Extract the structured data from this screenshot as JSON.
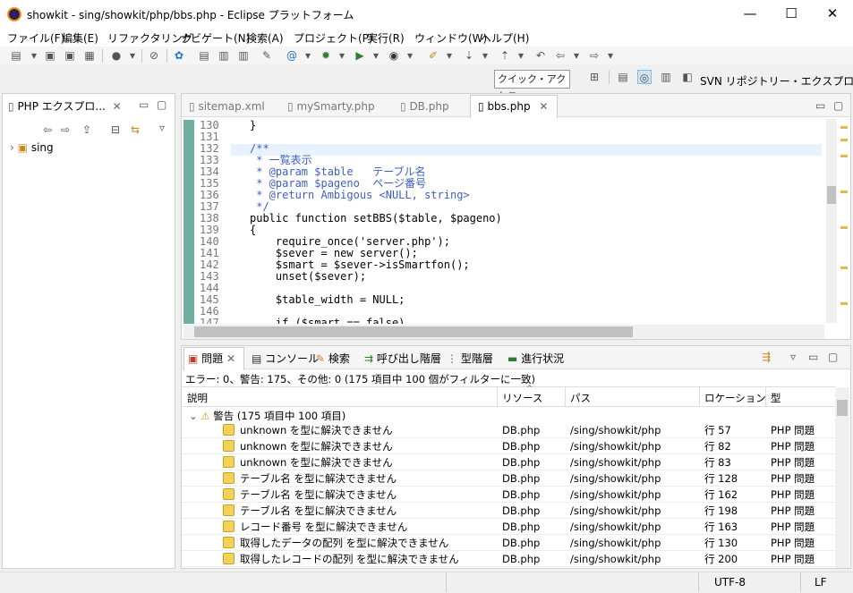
{
  "window": {
    "title": "showkit - sing/showkit/php/bbs.php - Eclipse プラットフォーム",
    "min": "—",
    "max": "☐",
    "close": "✕"
  },
  "menu": [
    "ファイル(F)",
    "編集(E)",
    "リファクタリング",
    "ナビゲート(N)",
    "検索(A)",
    "プロジェクト(P)",
    "実行(R)",
    "ウィンドウ(W)",
    "ヘルプ(H)"
  ],
  "quick_access": "クイック・アクセス",
  "perspective": "SVN リポジトリー・エクスプローラー",
  "left": {
    "tab": "PHP エクスプロ...",
    "tree_item": "sing"
  },
  "editor": {
    "tabs": [
      "sitemap.xml",
      "mySmarty.php",
      "DB.php",
      "bbs.php"
    ],
    "lines": [
      {
        "n": "130",
        "t": "}",
        "cls": ""
      },
      {
        "n": "131",
        "t": "",
        "cls": ""
      },
      {
        "n": "132",
        "t": "/**",
        "cls": "cm"
      },
      {
        "n": "133",
        "t": " * 一覧表示",
        "cls": "cm"
      },
      {
        "n": "134",
        "t": " * @param $table   テーブル名",
        "cls": "cm"
      },
      {
        "n": "135",
        "t": " * @param $pageno  ページ番号",
        "cls": "cm"
      },
      {
        "n": "136",
        "t": " * @return Ambigous <NULL, string>",
        "cls": "cm"
      },
      {
        "n": "137",
        "t": " */",
        "cls": "cm"
      },
      {
        "n": "138",
        "t": "public function setBBS($table, $pageno)",
        "cls": "fn"
      },
      {
        "n": "139",
        "t": "{",
        "cls": ""
      },
      {
        "n": "140",
        "t": "    require_once('server.php');",
        "cls": "req"
      },
      {
        "n": "141",
        "t": "    $sever = new server();",
        "cls": "new"
      },
      {
        "n": "142",
        "t": "    $smart = $sever->isSmartfon();",
        "cls": ""
      },
      {
        "n": "143",
        "t": "    unset($sever);",
        "cls": "unset"
      },
      {
        "n": "144",
        "t": "",
        "cls": ""
      },
      {
        "n": "145",
        "t": "    $table_width = NULL;",
        "cls": "null"
      },
      {
        "n": "146",
        "t": "",
        "cls": ""
      },
      {
        "n": "147",
        "t": "    if ($smart == false)",
        "cls": "if"
      }
    ]
  },
  "bottom": {
    "tabs": [
      "問題",
      "コンソール",
      "検索",
      "呼び出し階層",
      "型階層",
      "進行状況"
    ],
    "summary": "エラー: 0、警告: 175、その他: 0 (175 項目中 100 個がフィルターに一致)",
    "columns": [
      "説明",
      "リソース",
      "パス",
      "ロケーション",
      "型"
    ],
    "group": "警告 (175 項目中 100 項目)",
    "rows": [
      {
        "desc": "unknown を型に解決できません",
        "res": "DB.php",
        "path": "/sing/showkit/php",
        "loc": "行 57",
        "type": "PHP 問題"
      },
      {
        "desc": "unknown を型に解決できません",
        "res": "DB.php",
        "path": "/sing/showkit/php",
        "loc": "行 82",
        "type": "PHP 問題"
      },
      {
        "desc": "unknown を型に解決できません",
        "res": "DB.php",
        "path": "/sing/showkit/php",
        "loc": "行 83",
        "type": "PHP 問題"
      },
      {
        "desc": "テーブル名 を型に解決できません",
        "res": "DB.php",
        "path": "/sing/showkit/php",
        "loc": "行 128",
        "type": "PHP 問題"
      },
      {
        "desc": "テーブル名 を型に解決できません",
        "res": "DB.php",
        "path": "/sing/showkit/php",
        "loc": "行 162",
        "type": "PHP 問題"
      },
      {
        "desc": "テーブル名 を型に解決できません",
        "res": "DB.php",
        "path": "/sing/showkit/php",
        "loc": "行 198",
        "type": "PHP 問題"
      },
      {
        "desc": "レコード番号 を型に解決できません",
        "res": "DB.php",
        "path": "/sing/showkit/php",
        "loc": "行 163",
        "type": "PHP 問題"
      },
      {
        "desc": "取得したデータの配列 を型に解決できません",
        "res": "DB.php",
        "path": "/sing/showkit/php",
        "loc": "行 130",
        "type": "PHP 問題"
      },
      {
        "desc": "取得したレコードの配列 を型に解決できません",
        "res": "DB.php",
        "path": "/sing/showkit/php",
        "loc": "行 200",
        "type": "PHP 問題"
      }
    ]
  },
  "status": {
    "encoding": "UTF-8",
    "eol": "LF"
  }
}
